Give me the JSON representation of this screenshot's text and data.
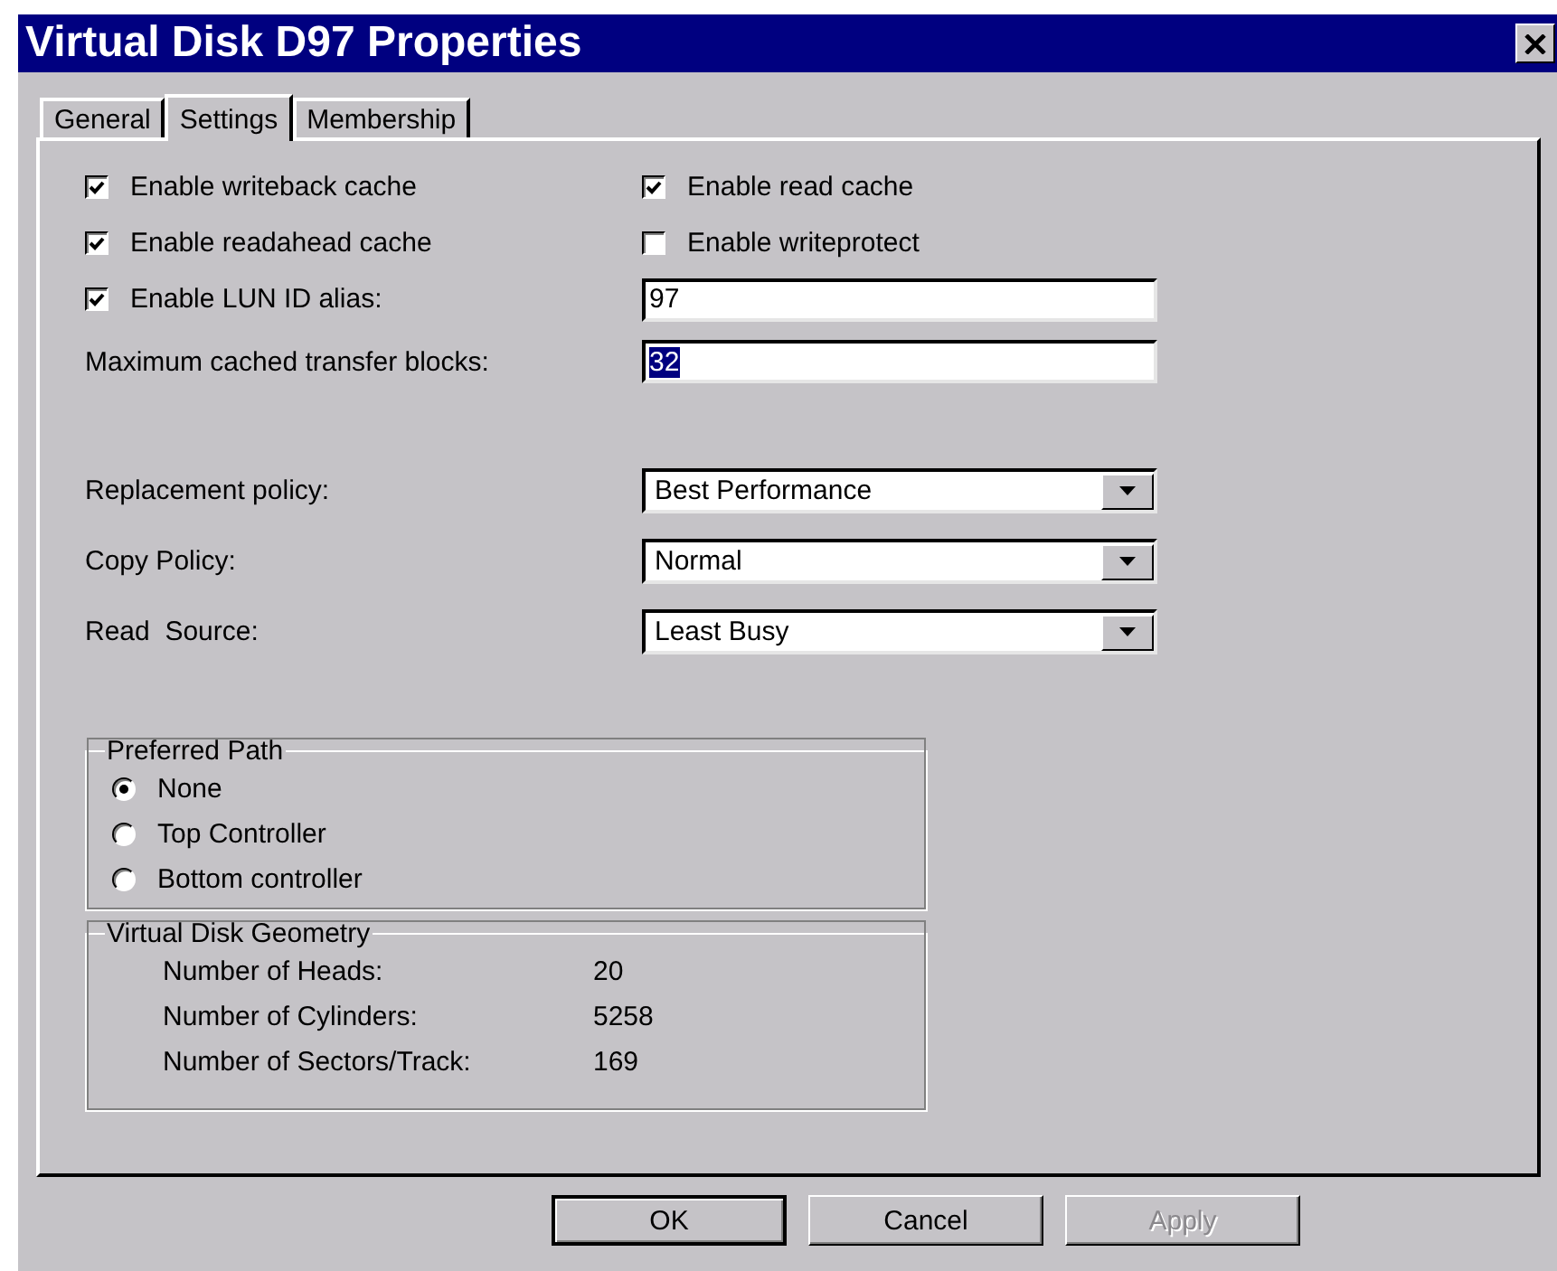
{
  "window": {
    "title": "Virtual Disk D97 Properties"
  },
  "tabs": [
    {
      "label": "General",
      "selected": false
    },
    {
      "label": "Settings",
      "selected": true
    },
    {
      "label": "Membership",
      "selected": false
    }
  ],
  "cache_options": [
    {
      "label": "Enable writeback cache",
      "checked": true
    },
    {
      "label": "Enable read cache",
      "checked": true
    },
    {
      "label": "Enable readahead cache",
      "checked": true
    },
    {
      "label": "Enable writeprotect",
      "checked": false
    }
  ],
  "lun_alias": {
    "label": "Enable LUN ID alias:",
    "checked": true,
    "value": "97"
  },
  "max_blocks": {
    "label": "Maximum cached transfer blocks:",
    "value": "32",
    "selected": true
  },
  "policies": [
    {
      "label": "Replacement policy:",
      "value": "Best Performance"
    },
    {
      "label": "Copy Policy:",
      "value": "Normal"
    },
    {
      "label": "Read  Source:",
      "value": "Least Busy"
    }
  ],
  "preferred_path": {
    "title": "Preferred Path",
    "options": [
      {
        "label": "None",
        "selected": true
      },
      {
        "label": "Top Controller",
        "selected": false
      },
      {
        "label": "Bottom controller",
        "selected": false
      }
    ]
  },
  "geometry": {
    "title": "Virtual Disk Geometry",
    "rows": [
      {
        "label": "Number of Heads:",
        "value": "20"
      },
      {
        "label": "Number of Cylinders:",
        "value": "5258"
      },
      {
        "label": "Number of Sectors/Track:",
        "value": "169"
      }
    ]
  },
  "buttons": [
    {
      "label": "OK",
      "default": true,
      "disabled": false
    },
    {
      "label": "Cancel",
      "default": false,
      "disabled": false
    },
    {
      "label": "Apply",
      "default": false,
      "disabled": true
    }
  ]
}
